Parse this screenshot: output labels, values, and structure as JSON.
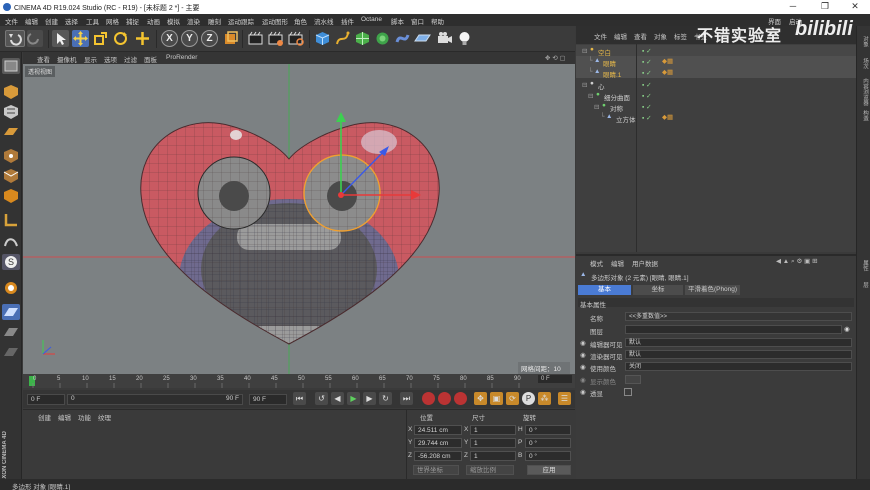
{
  "titlebar": {
    "title": "CINEMA 4D R19.024 Studio (RC - R19) - [未标题 2 *] - 主要",
    "minimize": "─",
    "maximize": "❐",
    "close": "✕"
  },
  "menubar": {
    "items": [
      "文件",
      "编辑",
      "创建",
      "选择",
      "工具",
      "网格",
      "捕捉",
      "动画",
      "模拟",
      "渲染",
      "雕刻",
      "运动跟踪",
      "运动图形",
      "角色",
      "流水线",
      "插件",
      "Octane",
      "脚本",
      "窗口",
      "帮助"
    ],
    "layout_label": "界面",
    "layout_value": "启动"
  },
  "toolbar": {
    "axis_x": "X",
    "axis_y": "Y",
    "axis_z": "Z"
  },
  "viewport": {
    "menu": [
      "查看",
      "摄像机",
      "显示",
      "选项",
      "过滤",
      "面板",
      "ProRender"
    ],
    "label": "透视视图",
    "grid_scale": "网格间距：10 cm"
  },
  "timeline": {
    "ticks": [
      "0",
      "5",
      "10",
      "15",
      "20",
      "25",
      "30",
      "35",
      "40",
      "45",
      "50",
      "55",
      "60",
      "65",
      "70",
      "75",
      "80",
      "85",
      "90"
    ],
    "current_frame_display": "0 F"
  },
  "transport": {
    "start_frame": "0 F",
    "min_frame": "0",
    "max_frame": "90 F",
    "end_frame": "90 F"
  },
  "material_manager": {
    "menu": [
      "创建",
      "编辑",
      "功能",
      "纹理"
    ]
  },
  "coordinates": {
    "col_position": "位置",
    "col_size": "尺寸",
    "col_rotation": "旋转",
    "rows": [
      {
        "axis": "X",
        "pos": "24.511 cm",
        "size_axis": "X",
        "size": "1",
        "rot_axis": "H",
        "rot": "0 °"
      },
      {
        "axis": "Y",
        "pos": "29.744 cm",
        "size_axis": "Y",
        "size": "1",
        "rot_axis": "P",
        "rot": "0 °"
      },
      {
        "axis": "Z",
        "pos": "-56.208 cm",
        "size_axis": "Z",
        "size": "1",
        "rot_axis": "B",
        "rot": "0 °"
      }
    ],
    "mode_dropdown": "世界坐标",
    "scale_dropdown": "缩放比例",
    "apply_button": "应用"
  },
  "object_manager": {
    "tabs": [
      "文件",
      "编辑",
      "查看",
      "对象",
      "标签",
      "书签"
    ],
    "objects": [
      {
        "name": "空白",
        "color": "#e6b84a",
        "indent": 0
      },
      {
        "name": "眼睛",
        "color": "#e6b84a",
        "indent": 1
      },
      {
        "name": "眼睛.1",
        "color": "#e6b84a",
        "indent": 1
      },
      {
        "name": "心",
        "color": "#cfcfcf",
        "indent": 0
      },
      {
        "name": "细分曲面",
        "color": "#cfcfcf",
        "indent": 1
      },
      {
        "name": "对称",
        "color": "#cfcfcf",
        "indent": 2
      },
      {
        "name": "立方体",
        "color": "#cfcfcf",
        "indent": 3
      }
    ]
  },
  "attribute_manager": {
    "menu": [
      "模式",
      "编辑",
      "用户数据"
    ],
    "object_header": "多边形对象 (2 元素) [眼睛, 眼睛.1]",
    "tabs": [
      "基本",
      "坐标",
      "平滑着色(Phong)"
    ],
    "section": "基本属性",
    "fields": [
      {
        "label": "名称",
        "value": "<<多重数值>>"
      },
      {
        "label": "图层",
        "value": ""
      },
      {
        "label": "编辑器可见",
        "value": "默认"
      },
      {
        "label": "渲染器可见",
        "value": "默认"
      },
      {
        "label": "使用颜色",
        "value": "关闭"
      },
      {
        "label": "显示颜色",
        "value": ""
      },
      {
        "label": "透显",
        "value": ""
      }
    ]
  },
  "statusbar": {
    "text": "多边形 对象 [眼睛.1]"
  },
  "right_strip": [
    "对象",
    "场次",
    "内容浏览器",
    "构造",
    "属性",
    "层"
  ],
  "watermark": {
    "text": "不错实验室",
    "brand": "bilibili"
  },
  "brand_side": "MAXON CINEMA 4D",
  "colors": {
    "accent_blue": "#4a7bd4",
    "selected_orange": "#e6b84a",
    "viewport_bg": "#7c8183"
  }
}
